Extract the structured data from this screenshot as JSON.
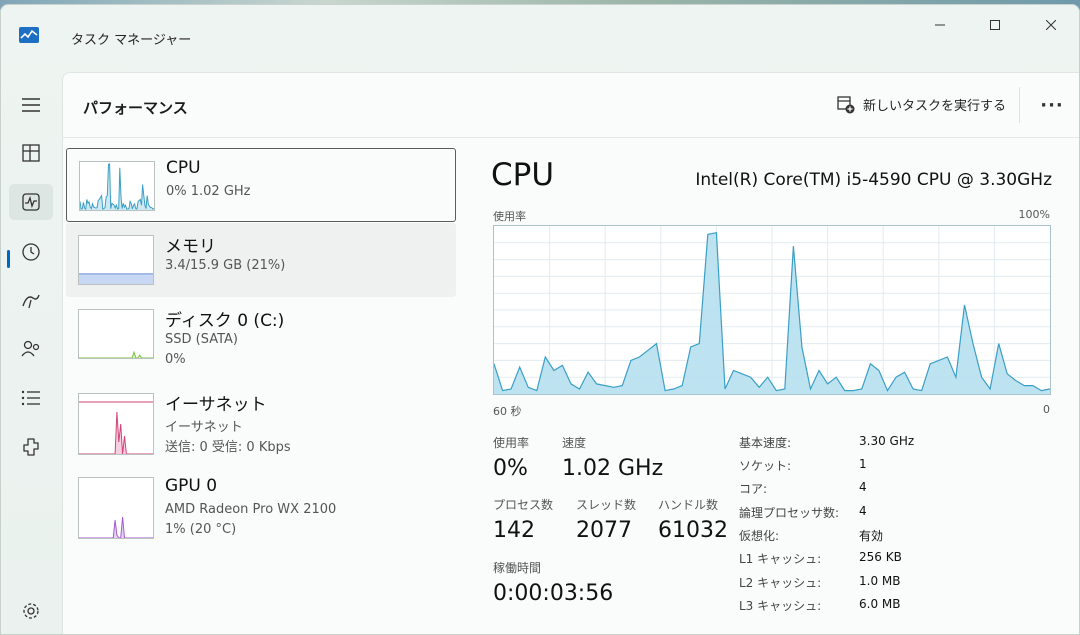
{
  "window": {
    "title": "タスク マネージャー",
    "controls": [
      "minimize",
      "maximize",
      "close"
    ]
  },
  "header": {
    "page_title": "パフォーマンス",
    "run_task_label": "新しいタスクを実行する",
    "more_label": "···"
  },
  "rail": {
    "items": [
      "menu-icon",
      "processes-icon",
      "performance-icon",
      "app-history-icon",
      "startup-icon",
      "users-icon",
      "details-icon",
      "services-icon",
      "settings-icon"
    ],
    "active": "performance-icon"
  },
  "devices": [
    {
      "name": "CPU",
      "line1": "0%  1.02 GHz",
      "line2": "",
      "color": "#3a9fc6"
    },
    {
      "name": "メモリ",
      "line1": "3.4/15.9 GB (21%)",
      "line2": "",
      "color": "#6a8fd6"
    },
    {
      "name": "ディスク 0 (C:)",
      "line1": "SSD (SATA)",
      "line2": "0%",
      "color": "#7cc23e"
    },
    {
      "name": "イーサネット",
      "line1": "イーサネット",
      "line2": "送信: 0  受信: 0 Kbps",
      "color": "#d2447a"
    },
    {
      "name": "GPU 0",
      "line1": "AMD Radeon Pro WX 2100",
      "line2": "1% (20 °C)",
      "color": "#a35ad1"
    }
  ],
  "detail": {
    "title": "CPU",
    "model": "Intel(R) Core(TM) i5-4590 CPU @ 3.30GHz",
    "y_label": "使用率",
    "y_max_label": "100%",
    "x_left_label": "60 秒",
    "x_right_label": "0",
    "graph_color": "#3a9fc6",
    "usage_series_percent": [
      18,
      2,
      3,
      16,
      4,
      2,
      22,
      14,
      17,
      6,
      3,
      13,
      6,
      5,
      4,
      5,
      20,
      22,
      26,
      30,
      2,
      3,
      5,
      28,
      30,
      95,
      96,
      3,
      14,
      12,
      10,
      4,
      10,
      2,
      3,
      88,
      28,
      3,
      14,
      6,
      10,
      2,
      2,
      3,
      18,
      14,
      2,
      10,
      13,
      3,
      2,
      18,
      20,
      22,
      10,
      53,
      30,
      10,
      3,
      30,
      12,
      8,
      5,
      5,
      2,
      3
    ]
  },
  "stats": {
    "usage": {
      "label": "使用率",
      "value": "0%"
    },
    "speed": {
      "label": "速度",
      "value": "1.02 GHz"
    },
    "processes": {
      "label": "プロセス数",
      "value": "142"
    },
    "threads": {
      "label": "スレッド数",
      "value": "2077"
    },
    "handles": {
      "label": "ハンドル数",
      "value": "61032"
    },
    "uptime": {
      "label": "稼働時間",
      "value": "0:00:03:56"
    }
  },
  "specs": [
    {
      "key": "基本速度:",
      "value": "3.30 GHz"
    },
    {
      "key": "ソケット:",
      "value": "1"
    },
    {
      "key": "コア:",
      "value": "4"
    },
    {
      "key": "論理プロセッサ数:",
      "value": "4"
    },
    {
      "key": "仮想化:",
      "value": "有効"
    },
    {
      "key": "L1 キャッシュ:",
      "value": "256 KB"
    },
    {
      "key": "L2 キャッシュ:",
      "value": "1.0 MB"
    },
    {
      "key": "L3 キャッシュ:",
      "value": "6.0 MB"
    }
  ]
}
